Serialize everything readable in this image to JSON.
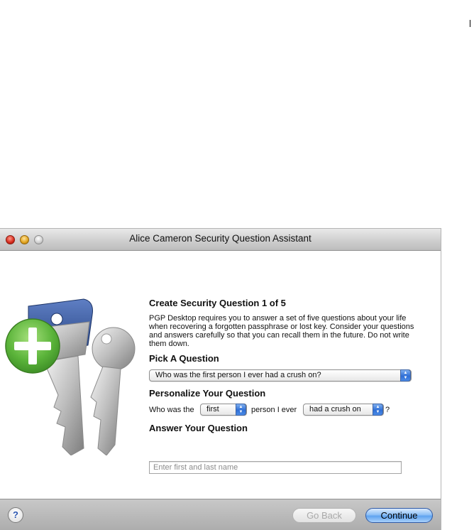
{
  "window": {
    "title": "Alice Cameron Security Question Assistant"
  },
  "form": {
    "heading": "Create Security Question 1 of 5",
    "description": "PGP Desktop requires you to answer a set of five questions about your life when recovering a forgotten passphrase or lost key.  Consider your questions and answers carefully so that you can recall them in the future.  Do not write them down.",
    "pick_heading": "Pick A Question",
    "question_selected": "Who was the first person I ever had a crush on?",
    "personalize_heading": "Personalize Your Question",
    "personalize": {
      "prefix": "Who was the",
      "word1": "first",
      "middle": "person I ever",
      "word2": "had a crush on",
      "suffix": "?"
    },
    "answer_heading": "Answer Your Question",
    "answer_placeholder": "Enter first and last name",
    "answer_value": ""
  },
  "footer": {
    "help_label": "?",
    "back_label": "Go Back",
    "continue_label": "Continue"
  },
  "icons": {
    "keys_art": "keys-with-plus-icon",
    "help": "question-mark-icon",
    "popup_arrows": "up-down-arrows-icon"
  },
  "colors": {
    "accent": "#5fa3f0",
    "plus_badge": "#6cc04a",
    "key_blue": "#2f5aa6"
  }
}
